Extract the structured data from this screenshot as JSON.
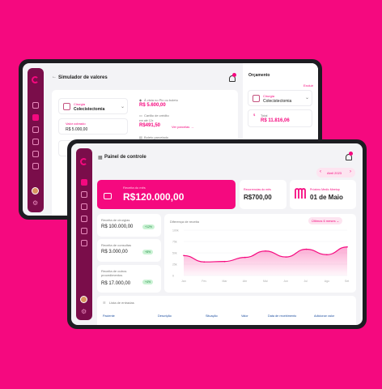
{
  "back": {
    "title": "Simulador de valores",
    "budget_label": "Orçamento",
    "delete_label": "Excluir",
    "procedure_category": "Cirurgia",
    "procedure_name": "Colecistectomia",
    "total_label": "Valor cobrado",
    "total_value": "R$ 5.000,00",
    "pix_label": "À vista no Pix ou boleto",
    "pix_value": "R$ 5.600,00",
    "card_label": "Cartão de crédito",
    "card_sub": "em até 12x",
    "card_value": "R$491,50",
    "card_link": "Ver parcelas →",
    "boleto_label": "Boleto parcelado",
    "right_category": "Cirurgia",
    "right_name": "Colecistectomia",
    "right_total_label": "Total",
    "right_total": "R$ 11.816,06"
  },
  "front": {
    "title": "Painel de controle",
    "date_filter": "Abril 2023",
    "revenue_label": "Receita do mês",
    "revenue_value": "R$120.000,00",
    "recurring_label": "Recorrencias do mês",
    "recurring_value": "R$700,00",
    "meetup_label": "Próximo Medic Meetup",
    "meetup_value": "01 de Maio",
    "stats": [
      {
        "label": "Receita de cirurgias",
        "value": "R$ 100.000,00",
        "badge": "+12%"
      },
      {
        "label": "Receita de consultas",
        "value": "R$ 3.000,00",
        "badge": "+8%"
      },
      {
        "label": "Receita de outros procedimentos",
        "value": "R$ 17.000,00",
        "badge": "+4%"
      }
    ],
    "chart_title": "Diferença de receita",
    "chart_filter": "Últimos 6 meses",
    "list_title": "Lista de entradas",
    "table_headers": [
      "Paciente",
      "Descrição",
      "Situação",
      "Valor",
      "Data de recebimento",
      "Adicionar valor"
    ]
  },
  "colors": {
    "accent": "#f5097f",
    "sidebar": "#7a0d4a"
  },
  "chart_data": {
    "type": "area",
    "x": [
      "Jan",
      "Fev",
      "Mar",
      "Abr",
      "Mai",
      "Jun",
      "Jul",
      "Ago",
      "Set"
    ],
    "yticks": [
      "100k",
      "75k",
      "50k",
      "25k",
      "0"
    ],
    "ylim": [
      0,
      100
    ],
    "values": [
      44,
      30,
      31,
      40,
      54,
      41,
      58,
      46,
      63
    ]
  }
}
